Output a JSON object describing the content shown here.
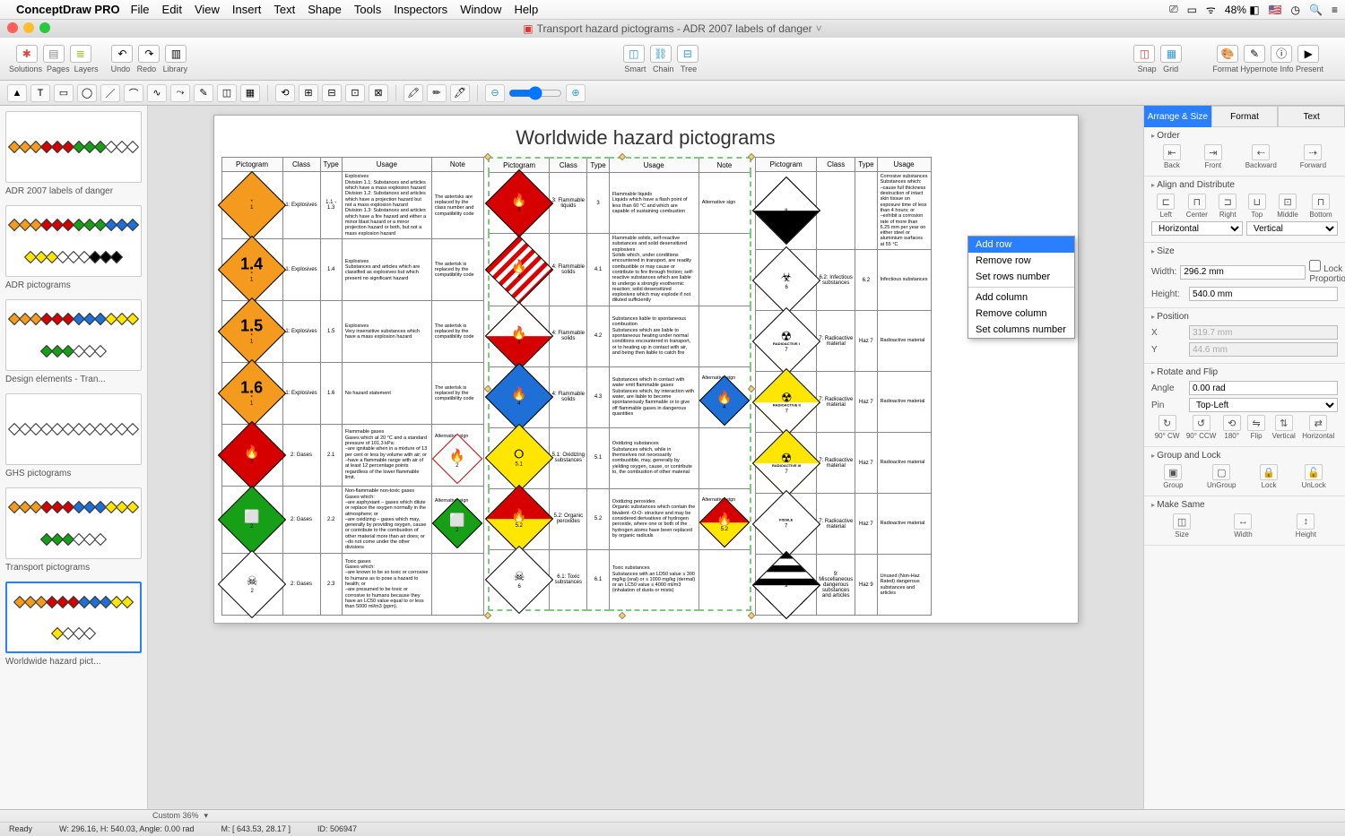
{
  "menubar": {
    "app": "ConceptDraw PRO",
    "items": [
      "File",
      "Edit",
      "View",
      "Insert",
      "Text",
      "Shape",
      "Tools",
      "Inspectors",
      "Window",
      "Help"
    ],
    "battery": "48%"
  },
  "titlebar": {
    "doc": "Transport hazard pictograms - ADR 2007 labels of danger"
  },
  "toolbar": {
    "g1": [
      "Solutions",
      "Pages",
      "Layers"
    ],
    "g2": [
      "Undo",
      "Redo",
      "Library"
    ],
    "g3": [
      "Smart",
      "Chain",
      "Tree"
    ],
    "g4": [
      "Snap",
      "Grid"
    ],
    "g5": [
      "Format",
      "Hypernote",
      "Info",
      "Present"
    ]
  },
  "sidebar": {
    "items": [
      {
        "label": "ADR 2007 labels of danger"
      },
      {
        "label": "ADR pictograms"
      },
      {
        "label": "Design elements - Tran..."
      },
      {
        "label": "GHS pictograms"
      },
      {
        "label": "Transport pictograms"
      },
      {
        "label": "Worldwide hazard pict...",
        "selected": true
      }
    ]
  },
  "doc": {
    "title": "Worldwide hazard pictograms",
    "headers": [
      "Pictogram",
      "Class",
      "Type",
      "Usage",
      "Note"
    ],
    "t1": [
      {
        "class": "1: Explosives",
        "type": "1.1 - 1.3",
        "usage": "Explosives\n  Division 1.1: Substances and articles which have a mass explosion hazard\n  Division 1.2: Substances and articles which have a projection hazard but not a mass explosion hazard\n  Division 1.3: Substances and articles which have a fire hazard and either a minor blast hazard or a minor projection hazard or both, but not a mass explosion hazard",
        "note": "The asterisks are replaced by the class number and compatibility code",
        "pic": {
          "bg": "#f39a1f",
          "txt": "*\n1"
        }
      },
      {
        "class": "1: Explosives",
        "type": "1.4",
        "usage": "Explosives\nSubstances and articles which are classified as explosives but which present no significant hazard",
        "note": "The asterisk is replaced by the compatibility code",
        "pic": {
          "bg": "#f39a1f",
          "big": "1.4"
        }
      },
      {
        "class": "1: Explosives",
        "type": "1.5",
        "usage": "Explosives\nVery insensitive substances which have a mass explosion hazard",
        "note": "The asterisk is replaced by the compatibility code",
        "pic": {
          "bg": "#f39a1f",
          "big": "1.5"
        }
      },
      {
        "class": "1: Explosives",
        "type": "1.6",
        "usage": "No hazard statement",
        "note": "The asterisk is replaced by the compatibility code",
        "pic": {
          "bg": "#f39a1f",
          "big": "1.6"
        }
      },
      {
        "class": "2: Gases",
        "type": "2.1",
        "usage": "Flammable gases\nGases which at 20 °C and a standard pressure of 101.3 kPa:\n–are ignitable when in a mixture of 13 per cent or less by volume with air; or\n–have a flammable range with air of at least 12 percentage points regardless of the lower flammable limit.",
        "note": "Alternative sign",
        "pic": {
          "bg": "#d60000",
          "sym": "🔥",
          "num": "2"
        },
        "alt": {
          "bg": "#fff",
          "br": "#d60000",
          "sym": "🔥",
          "num": "2"
        }
      },
      {
        "class": "2: Gases",
        "type": "2.2",
        "usage": "Non-flammable non-toxic gases\nGases which:\n–are asphyxiant – gases which dilute or replace the oxygen normally in the atmosphere; or\n–are oxidizing – gases which may, generally by providing oxygen, cause or contribute to the combustion of other material more than air does; or\n–do not come under the other divisions",
        "note": "Alternative sign",
        "pic": {
          "bg": "#17a017",
          "sym": "⬜",
          "num": "2"
        },
        "alt": {
          "bg": "#17a017",
          "sym": "⬜",
          "num": "2"
        }
      },
      {
        "class": "2: Gases",
        "type": "2.3",
        "usage": "Toxic gases\nGases which:\n–are known to be so toxic or corrosive to humans as to pose a hazard to health; or\n–are presumed to be toxic or corrosive to humans because they have an LC50 value equal to or less than 5000 ml/m3 (ppm).",
        "note": "",
        "pic": {
          "bg": "#fff",
          "sym": "☠",
          "num": "2"
        }
      }
    ],
    "t2": [
      {
        "class": "3: Flammable liquids",
        "type": "3",
        "usage": "Flammable liquids\nLiquids which have a flash point of less than 60 °C and which are capable of sustaining combustion",
        "note": "Alternative sign",
        "pic": {
          "bg": "#d60000",
          "sym": "🔥",
          "num": "3"
        }
      },
      {
        "class": "4: Flammable solids",
        "type": "4.1",
        "usage": "Flammable solids, self-reactive substances and solid desensitized explosives\nSolids which, under conditions encountered in transport, are readily combustible or may cause or contribute to fire through friction; self-reactive substances which are liable to undergo a strongly exothermic reaction; solid desensitized explosives which may explode if not diluted sufficiently",
        "note": "",
        "pic": {
          "stripes": true,
          "sym": "🔥",
          "num": "4"
        }
      },
      {
        "class": "4: Flammable solids",
        "type": "4.2",
        "usage": "Substances liable to spontaneous combustion\nSubstances which are liable to spontaneous heating under normal conditions encountered in transport, or to heating up in contact with air, and being then liable to catch fire",
        "note": "",
        "pic": {
          "bg": "#fff",
          "bot": "#d60000",
          "sym": "🔥",
          "num": "4"
        }
      },
      {
        "class": "4: Flammable solids",
        "type": "4.3",
        "usage": "Substances which in contact with water emit flammable gases\nSubstances which, by interaction with water, are liable to become spontaneously flammable or to give off flammable gases in dangerous quantities",
        "note": "Alternative sign",
        "pic": {
          "bg": "#1e6fd6",
          "sym": "🔥",
          "num": "4"
        },
        "alt": {
          "bg": "#1e6fd6",
          "sym": "🔥",
          "num": "4"
        }
      },
      {
        "class": "5.1: Oxidizing substances",
        "type": "5.1",
        "usage": "Oxidizing substances\nSubstances which, while in themselves not necessarily combustible, may, generally by yielding oxygen, cause, or contribute to, the combustion of other material",
        "note": "",
        "pic": {
          "bg": "#ffe600",
          "sym": "⭘",
          "num": "5.1"
        }
      },
      {
        "class": "5.2: Organic peroxides",
        "type": "5.2",
        "usage": "Oxidizing peroxides\nOrganic substances which contain the bivalent -O-O- structure and may be considered derivatives of hydrogen peroxide, where one or both of the hydrogen atoms have been replaced by organic radicals",
        "note": "Alternative sign",
        "pic": {
          "bg": "#d60000",
          "bot": "#ffe600",
          "sym": "🔥",
          "num": "5.2"
        },
        "alt": {
          "bg": "#d60000",
          "bot": "#ffe600",
          "sym": "🔥",
          "num": "5.2"
        }
      },
      {
        "class": "6.1: Toxic substances",
        "type": "6.1",
        "usage": "Toxic substances\nSubstances with an LD50 value ≤ 300 mg/kg (oral) or ≤ 1000 mg/kg (dermal) or an LC50 value ≤ 4000 ml/m3 (inhalation of dusts or mists)",
        "note": "",
        "pic": {
          "bg": "#fff",
          "sym": "☠",
          "num": "6"
        }
      }
    ],
    "t3": [
      {
        "class": "",
        "type": "",
        "usage": "Corrosive substances\nSubstances which:\n–cause full thickness destruction of intact skin tissue on exposure time of less than 4 hours; or\n–exhibit a corrosion rate of more than 6.25 mm per year on either steel or aluminium surfaces at 55 °C",
        "note": "",
        "pic": {
          "bg": "#fff",
          "bot": "#000",
          "num": "8",
          "bw": true
        }
      },
      {
        "class": "6.2: Infectious substances",
        "type": "6.2",
        "usage": "Infectious substances",
        "note": "",
        "pic": {
          "bg": "#fff",
          "sym": "☣",
          "num": "6"
        }
      },
      {
        "class": "7: Radioactive material",
        "type": "Haz 7",
        "usage": "Radioactive material",
        "note": "",
        "pic": {
          "bg": "#fff",
          "sym": "☢",
          "lbl": "RADIOACTIVE I",
          "num": "7"
        }
      },
      {
        "class": "7: Radioactive material",
        "type": "Haz 7",
        "usage": "Radioactive material",
        "note": "",
        "pic": {
          "bg": "#ffe600",
          "bot": "#fff",
          "sym": "☢",
          "lbl": "RADIOACTIVE II",
          "num": "7"
        }
      },
      {
        "class": "7: Radioactive material",
        "type": "Haz 7",
        "usage": "Radioactive material",
        "note": "",
        "pic": {
          "bg": "#ffe600",
          "bot": "#fff",
          "sym": "☢",
          "lbl": "RADIOACTIVE III",
          "num": "7"
        }
      },
      {
        "class": "7: Radioactive material",
        "type": "Haz 7",
        "usage": "Radioactive material",
        "note": "",
        "pic": {
          "bg": "#fff",
          "lbl": "FISSILE",
          "num": "7"
        }
      },
      {
        "class": "9: Miscellaneous dangerous substances and articles",
        "type": "Haz 9",
        "usage": "Unused (Non-Haz Rated) dangerous substances and articles",
        "note": "",
        "pic": {
          "bwtop": true,
          "num": "9"
        }
      }
    ]
  },
  "ctx": {
    "items": [
      "Add row",
      "Remove row",
      "Set rows number",
      "",
      "Add column",
      "Remove column",
      "Set columns number"
    ],
    "sel": 0
  },
  "rpanel": {
    "tabs": [
      "Arrange & Size",
      "Format",
      "Text"
    ],
    "order": {
      "h": "Order",
      "btns": [
        "Back",
        "Front",
        "Backward",
        "Forward"
      ]
    },
    "align": {
      "h": "Align and Distribute",
      "btns": [
        "Left",
        "Center",
        "Right",
        "Top",
        "Middle",
        "Bottom"
      ],
      "horiz": "Horizontal",
      "vert": "Vertical"
    },
    "size": {
      "h": "Size",
      "w": "296.2 mm",
      "hgt": "540.0 mm",
      "lock": "Lock Proportions"
    },
    "pos": {
      "h": "Position",
      "x": "319.7 mm",
      "y": "44.6 mm"
    },
    "rot": {
      "h": "Rotate and Flip",
      "angle": "0.00 rad",
      "pin": "Top-Left",
      "btns": [
        "90° CW",
        "90° CCW",
        "180°",
        "Flip",
        "Vertical",
        "Horizontal"
      ]
    },
    "grp": {
      "h": "Group and Lock",
      "btns": [
        "Group",
        "UnGroup",
        "Lock",
        "UnLock"
      ]
    },
    "same": {
      "h": "Make Same",
      "btns": [
        "Size",
        "Width",
        "Height"
      ]
    },
    "wlbl": "Width:",
    "hlbl": "Height:",
    "xlbl": "X",
    "ylbl": "Y",
    "anglbl": "Angle",
    "pinlbl": "Pin"
  },
  "status": {
    "zoom": "Custom 36%",
    "ready": "Ready",
    "wh": "W: 296.16,  H: 540.03,  Angle: 0.00 rad",
    "m": "M: [ 643.53, 28.17 ]",
    "id": "ID: 506947"
  }
}
